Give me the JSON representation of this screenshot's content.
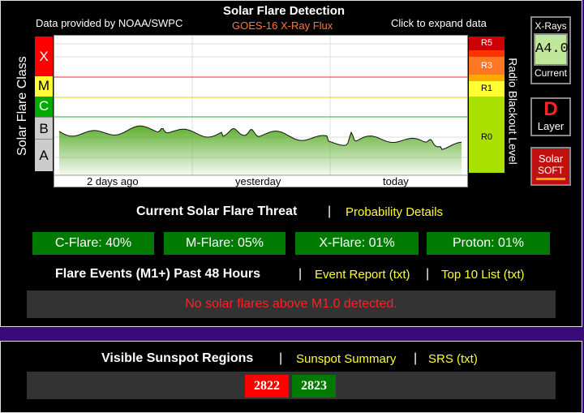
{
  "flare": {
    "source": "Data provided by NOAA/SWPC",
    "title": "Solar Flare Detection",
    "subtitle": "GOES-16 X-Ray Flux",
    "expand": "Click to expand data",
    "y_axis_label": "Solar Flare Class",
    "right_axis_label": "Radio Blackout Level",
    "classes": [
      "X",
      "M",
      "C",
      "B",
      "A"
    ],
    "blackout_levels": [
      "R5",
      "R3",
      "R1",
      "R0"
    ],
    "x_ticks": [
      "2 days ago",
      "yesterday",
      "today"
    ],
    "xray": {
      "top": "X-Rays",
      "value": "A4.0",
      "bottom": "Current"
    },
    "layer": {
      "letter": "D",
      "label": "Layer"
    },
    "solar_soft": {
      "line1": "Solar",
      "line2": "SOFT"
    }
  },
  "threat": {
    "title": "Current Solar Flare Threat",
    "separator": "|",
    "link": "Probability Details",
    "items": [
      {
        "label": "C-Flare: 40%"
      },
      {
        "label": "M-Flare: 05%"
      },
      {
        "label": "X-Flare: 01%"
      },
      {
        "label": "Proton: 01%"
      }
    ]
  },
  "events": {
    "title": "Flare Events (M1+) Past 48 Hours",
    "separator": "|",
    "report_link": "Event Report (txt)",
    "top10_link": "Top 10 List (txt)",
    "message": "No solar flares above M1.0 detected."
  },
  "sunspots": {
    "title": "Visible Sunspot Regions",
    "separator": "|",
    "summary_link": "Sunspot Summary",
    "srs_link": "SRS (txt)",
    "regions": [
      {
        "number": "2822",
        "color": "#ff0000"
      },
      {
        "number": "2823",
        "color": "#007a00"
      }
    ]
  },
  "colors": {
    "x_class": "#ff0000",
    "m_class": "#ffff33",
    "c_class": "#00aa00",
    "b_class": "#cccccc",
    "a_class": "#cccccc",
    "r5": "#cc0000",
    "r3": "#ff6600",
    "r1": "#ffff33",
    "r0": "#a9e000",
    "flux_green": "#55aa22",
    "button_green": "#007a00"
  }
}
